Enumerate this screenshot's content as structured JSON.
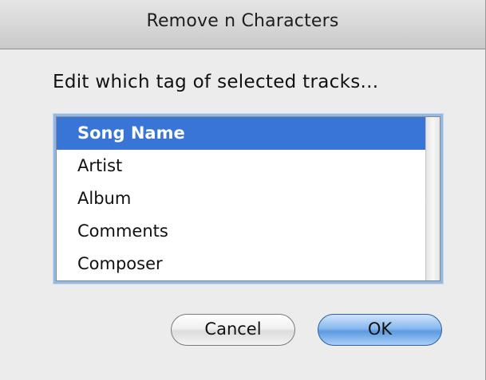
{
  "window": {
    "title": "Remove n Characters"
  },
  "dialog": {
    "prompt": "Edit which tag of selected tracks..."
  },
  "list": {
    "items": [
      {
        "label": "Song Name",
        "selected": true
      },
      {
        "label": "Artist",
        "selected": false
      },
      {
        "label": "Album",
        "selected": false
      },
      {
        "label": "Comments",
        "selected": false
      },
      {
        "label": "Composer",
        "selected": false
      }
    ]
  },
  "buttons": {
    "cancel_label": "Cancel",
    "ok_label": "OK"
  },
  "colors": {
    "selection": "#3875d7",
    "focus_ring": "#93b8e4",
    "default_button": "#5b9ae0"
  }
}
